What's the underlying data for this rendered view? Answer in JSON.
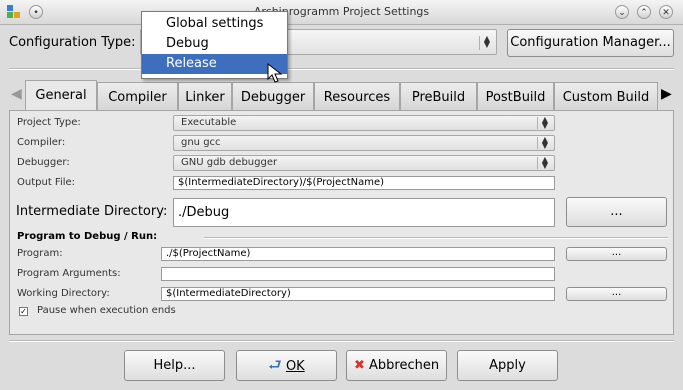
{
  "window": {
    "title": "Archiprogramm Project Settings"
  },
  "top": {
    "config_type_label": "Configuration Type:",
    "config_manager_button": "Configuration Manager...",
    "dropdown_options": [
      "Global settings",
      "Debug",
      "Release"
    ],
    "dropdown_selected": "Release"
  },
  "tabs": [
    "General",
    "Compiler",
    "Linker",
    "Debugger",
    "Resources",
    "PreBuild",
    "PostBuild",
    "Custom Build"
  ],
  "active_tab": "General",
  "general": {
    "project_type_label": "Project Type:",
    "project_type_value": "Executable",
    "compiler_label": "Compiler:",
    "compiler_value": "gnu gcc",
    "debugger_label": "Debugger:",
    "debugger_value": "GNU gdb debugger",
    "output_file_label": "Output File:",
    "output_file_value": "$(IntermediateDirectory)/$(ProjectName)",
    "intermediate_dir_label": "Intermediate Directory:",
    "intermediate_dir_value": "./Debug",
    "browse_label": "...",
    "section_title": "Program to Debug / Run:",
    "program_label": "Program:",
    "program_value": "./$(ProjectName)",
    "program_args_label": "Program Arguments:",
    "program_args_value": "",
    "working_dir_label": "Working Directory:",
    "working_dir_value": "$(IntermediateDirectory)",
    "pause_label": "Pause when execution ends",
    "pause_checked": true
  },
  "buttons": {
    "help": "Help...",
    "ok": "OK",
    "cancel": "Abbrechen",
    "apply": "Apply"
  }
}
